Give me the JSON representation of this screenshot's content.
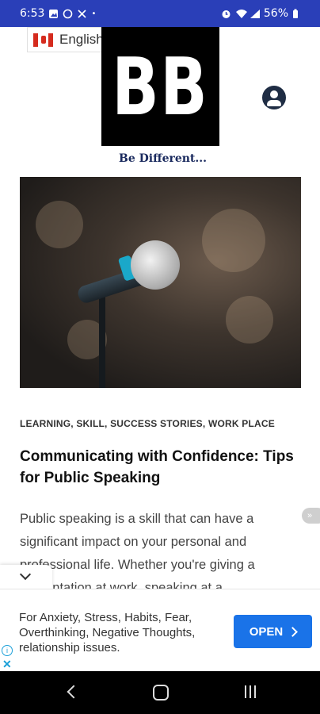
{
  "status_bar": {
    "time": "6:53",
    "battery": "56%"
  },
  "language": {
    "selected": "English"
  },
  "logo": {
    "text": "BB",
    "tagline": "Be Different..."
  },
  "article": {
    "categories": "LEARNING, SKILL, SUCCESS STORIES, WORK PLACE",
    "title": "Communicating with Confidence: Tips for Public Speaking",
    "excerpt": "Public speaking is a skill that can have a significant impact on your personal and professional life. Whether you're giving a presentation at work, speaking at a"
  },
  "ad": {
    "text": "For Anxiety, Stress, Habits, Fear, Overthinking, Negative Thoughts, relationship issues.",
    "button": "OPEN"
  },
  "colors": {
    "status_bar": "#2a3fb8",
    "ad_button": "#1a73e8"
  },
  "icons": [
    "photo-icon",
    "sync-icon",
    "scissors-icon",
    "alarm-icon",
    "wifi-icon",
    "signal-icon",
    "battery-icon",
    "user-account-icon",
    "info-icon",
    "close-icon",
    "chevron-down-icon",
    "back-icon",
    "home-icon",
    "recents-icon"
  ]
}
